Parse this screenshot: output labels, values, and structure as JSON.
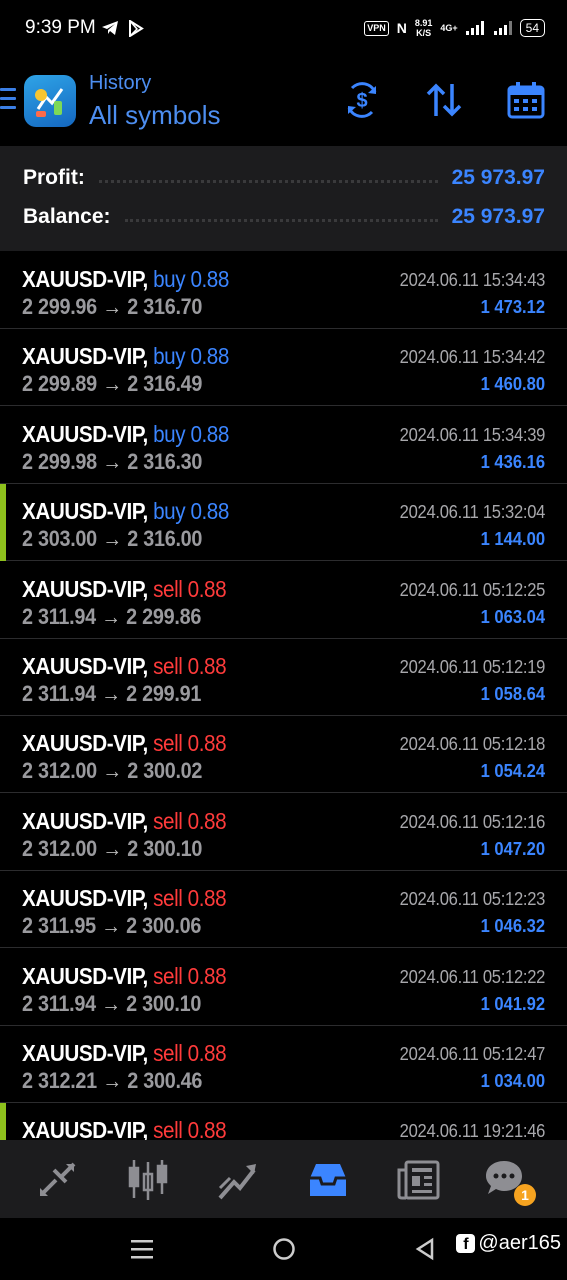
{
  "status_bar": {
    "time": "9:39 PM",
    "vpn": "VPN",
    "nfc": "N",
    "speed_value": "8.91",
    "speed_unit": "K/S",
    "network": "4G+",
    "battery": "54"
  },
  "header": {
    "subtitle": "History",
    "title": "All symbols",
    "icons": [
      "menu-icon",
      "app-logo",
      "currency-exchange-icon",
      "sort-icon",
      "calendar-icon"
    ]
  },
  "summary": {
    "profit_label": "Profit:",
    "profit_value": "25 973.97",
    "balance_label": "Balance:",
    "balance_value": "25 973.97"
  },
  "trades": [
    {
      "symbol": "XAUUSD-VIP,",
      "side": "buy",
      "volume": "0.88",
      "open": "2 299.96",
      "close": "2 316.70",
      "time": "2024.06.11 15:34:43",
      "profit": "1 473.12",
      "marked": false
    },
    {
      "symbol": "XAUUSD-VIP,",
      "side": "buy",
      "volume": "0.88",
      "open": "2 299.89",
      "close": "2 316.49",
      "time": "2024.06.11 15:34:42",
      "profit": "1 460.80",
      "marked": false
    },
    {
      "symbol": "XAUUSD-VIP,",
      "side": "buy",
      "volume": "0.88",
      "open": "2 299.98",
      "close": "2 316.30",
      "time": "2024.06.11 15:34:39",
      "profit": "1 436.16",
      "marked": false
    },
    {
      "symbol": "XAUUSD-VIP,",
      "side": "buy",
      "volume": "0.88",
      "open": "2 303.00",
      "close": "2 316.00",
      "time": "2024.06.11 15:32:04",
      "profit": "1 144.00",
      "marked": true
    },
    {
      "symbol": "XAUUSD-VIP,",
      "side": "sell",
      "volume": "0.88",
      "open": "2 311.94",
      "close": "2 299.86",
      "time": "2024.06.11 05:12:25",
      "profit": "1 063.04",
      "marked": false
    },
    {
      "symbol": "XAUUSD-VIP,",
      "side": "sell",
      "volume": "0.88",
      "open": "2 311.94",
      "close": "2 299.91",
      "time": "2024.06.11 05:12:19",
      "profit": "1 058.64",
      "marked": false
    },
    {
      "symbol": "XAUUSD-VIP,",
      "side": "sell",
      "volume": "0.88",
      "open": "2 312.00",
      "close": "2 300.02",
      "time": "2024.06.11 05:12:18",
      "profit": "1 054.24",
      "marked": false
    },
    {
      "symbol": "XAUUSD-VIP,",
      "side": "sell",
      "volume": "0.88",
      "open": "2 312.00",
      "close": "2 300.10",
      "time": "2024.06.11 05:12:16",
      "profit": "1 047.20",
      "marked": false
    },
    {
      "symbol": "XAUUSD-VIP,",
      "side": "sell",
      "volume": "0.88",
      "open": "2 311.95",
      "close": "2 300.06",
      "time": "2024.06.11 05:12:23",
      "profit": "1 046.32",
      "marked": false
    },
    {
      "symbol": "XAUUSD-VIP,",
      "side": "sell",
      "volume": "0.88",
      "open": "2 311.94",
      "close": "2 300.10",
      "time": "2024.06.11 05:12:22",
      "profit": "1 041.92",
      "marked": false
    },
    {
      "symbol": "XAUUSD-VIP,",
      "side": "sell",
      "volume": "0.88",
      "open": "2 312.21",
      "close": "2 300.46",
      "time": "2024.06.11 05:12:47",
      "profit": "1 034.00",
      "marked": false
    },
    {
      "symbol": "XAUUSD-VIP,",
      "side": "sell",
      "volume": "0.88",
      "open": "",
      "close": "",
      "time": "2024.06.11 19:21:46",
      "profit": "",
      "marked": true
    }
  ],
  "arrow": "→",
  "bottom_nav": {
    "items": [
      "quotes-icon",
      "chart-icon",
      "trade-icon",
      "history-icon",
      "news-icon",
      "chat-icon"
    ],
    "active": "history-icon",
    "chat_badge": "1"
  },
  "colors": {
    "accent": "#3b85ff",
    "buy": "#3b85ff",
    "sell": "#ff3b3b",
    "marker": "#8ec11d"
  },
  "watermark": "@aer165"
}
